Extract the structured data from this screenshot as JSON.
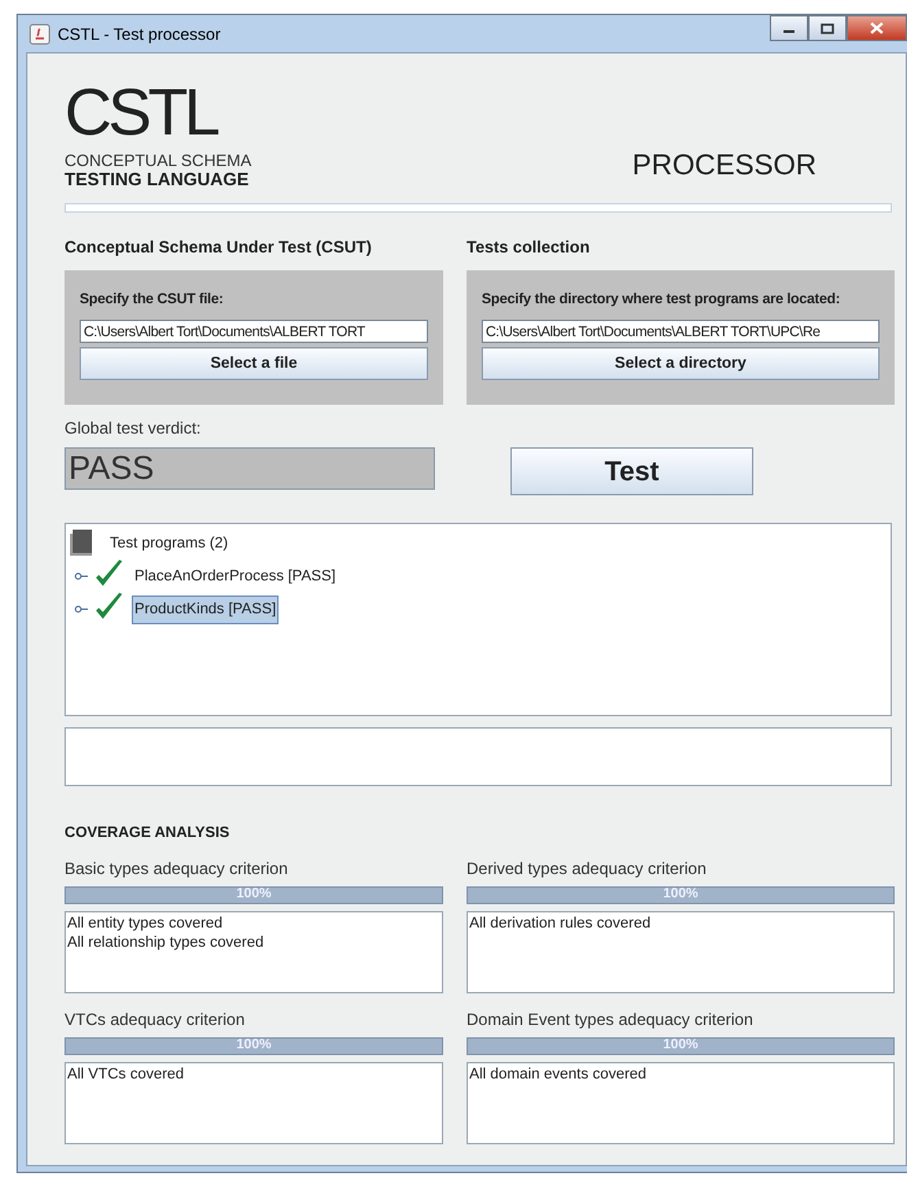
{
  "window": {
    "title": "CSTL - Test processor"
  },
  "logo": {
    "mark": "CS**TL**",
    "line_1": "CONCEPTUAL SCHEMA",
    "line_2": "TESTING LANGUAGE"
  },
  "heading": "PROCESSOR",
  "csut": {
    "title": "Conceptual Schema Under Test (CSUT)",
    "prompt": "Specify the CSUT file:",
    "value": "C:\\Users\\Albert Tort\\Documents\\ALBERT TORT",
    "button": "Select a file"
  },
  "tests_collection": {
    "title": "Tests collection",
    "prompt": "Specify the directory where test programs are located:",
    "value": "C:\\Users\\Albert Tort\\Documents\\ALBERT TORT\\UPC\\Re",
    "button": "Select a directory"
  },
  "verdict": {
    "label": "Global test verdict:",
    "value": "PASS"
  },
  "test_button": "Test",
  "tree": {
    "label": "Test programs (2)",
    "children": [
      {
        "label": "PlaceAnOrderProcess [PASS]",
        "selected": false
      },
      {
        "label": "ProductKinds [PASS]",
        "selected": true
      }
    ]
  },
  "coverage": {
    "title": "COVERAGE ANALYSIS",
    "criteria": [
      {
        "label": "Basic types adequacy criterion",
        "level": 1,
        "reading": "100%",
        "lines": [
          "All entity types covered",
          "All relationship types covered"
        ]
      },
      {
        "label": "Derived types adequacy criterion",
        "level": 1,
        "reading": "100%",
        "lines": [
          "All derivation rules covered"
        ]
      },
      {
        "label": "VTCs adequacy criterion",
        "level": 1,
        "reading": "100%",
        "lines": [
          "All VTCs covered"
        ]
      },
      {
        "label": "Domain Event types adequacy criterion",
        "level": 1,
        "reading": "100%",
        "lines": [
          "All domain events covered"
        ]
      }
    ]
  }
}
